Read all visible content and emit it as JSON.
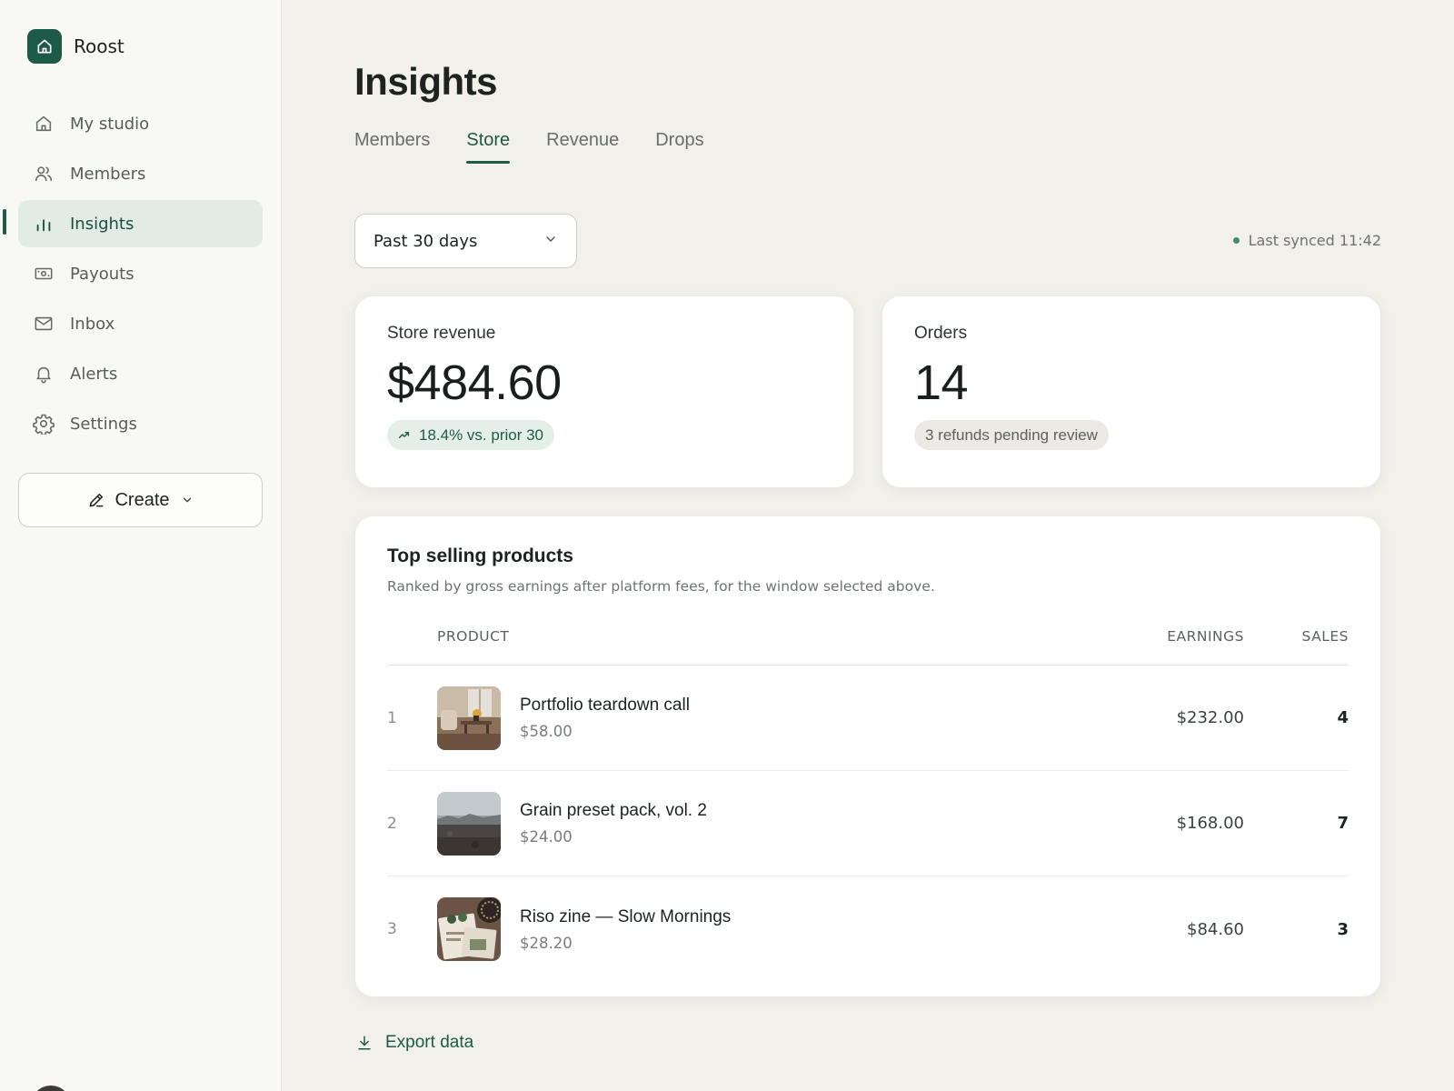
{
  "app": {
    "name": "Roost",
    "logo_icon": "house-icon"
  },
  "colors": {
    "accent": "#1e5a48",
    "accent_soft": "#e3ebe7",
    "background": "#f1f0eb",
    "sidebar": "#f8f8f4"
  },
  "sidebar": {
    "items": [
      {
        "label": "My studio",
        "icon": "home-icon",
        "active": false
      },
      {
        "label": "Members",
        "icon": "users-icon",
        "active": false
      },
      {
        "label": "Insights",
        "icon": "bar-chart-icon",
        "active": true
      },
      {
        "label": "Payouts",
        "icon": "banknote-icon",
        "active": false
      },
      {
        "label": "Inbox",
        "icon": "mail-icon",
        "active": false
      },
      {
        "label": "Alerts",
        "icon": "bell-icon",
        "active": false
      },
      {
        "label": "Settings",
        "icon": "gear-icon",
        "active": false
      }
    ],
    "create_label": "Create"
  },
  "page": {
    "title": "Insights",
    "tabs": [
      {
        "label": "Members",
        "active": false
      },
      {
        "label": "Store",
        "active": true
      },
      {
        "label": "Revenue",
        "active": false
      },
      {
        "label": "Drops",
        "active": false
      }
    ]
  },
  "filters": {
    "range": "Past 30 days",
    "sync_status": "Last synced 11:42"
  },
  "stats": {
    "revenue": {
      "label": "Store revenue",
      "value": "$484.60",
      "delta": "18.4% vs. prior 30"
    },
    "orders": {
      "label": "Orders",
      "value": "14",
      "note": "3 refunds pending review"
    }
  },
  "products": {
    "title": "Top selling products",
    "subtitle": "Ranked by gross earnings after platform fees, for the window selected above.",
    "columns": {
      "product": "PRODUCT",
      "earnings": "EARNINGS",
      "sales": "SALES"
    },
    "rows": [
      {
        "rank": "1",
        "name": "Portfolio teardown call",
        "price": "$58.00",
        "earnings": "$232.00",
        "sales": "4"
      },
      {
        "rank": "2",
        "name": "Grain preset pack, vol. 2",
        "price": "$24.00",
        "earnings": "$168.00",
        "sales": "7"
      },
      {
        "rank": "3",
        "name": "Riso zine — Slow Mornings",
        "price": "$28.20",
        "earnings": "$84.60",
        "sales": "3"
      }
    ]
  },
  "export_label": "Export data"
}
